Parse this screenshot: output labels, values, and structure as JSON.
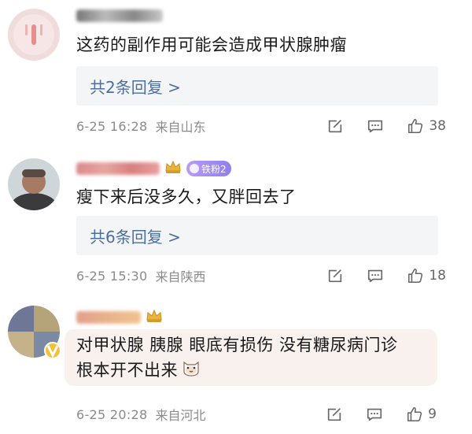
{
  "comments": [
    {
      "username": "",
      "body_lines": [
        "这药的副作用可能会造成甲状腺肿瘤"
      ],
      "replies_label": "共2条回复 >",
      "time": "6-25 16:28",
      "location": "来自山东",
      "like_count": "38"
    },
    {
      "username": "",
      "fan_badge": "铁粉2",
      "body_lines": [
        "瘦下来后没多久，又胖回去了"
      ],
      "replies_label": "共6条回复 >",
      "time": "6-25 15:30",
      "location": "来自陕西",
      "like_count": "18"
    },
    {
      "username": "",
      "body_lines": [
        "对甲状腺 胰腺 眼底有损伤 没有糖尿病门诊",
        "根本开不出来"
      ],
      "time": "6-25 20:28",
      "location": "来自河北",
      "like_count": "9"
    }
  ],
  "icons": {
    "repost": "repost-icon",
    "comment": "comment-icon",
    "like": "thumbs-up-icon",
    "emoji": "cat-face-emoji-icon",
    "verified": "verified-v-icon",
    "crown": "crown-icon"
  },
  "colors": {
    "link": "#4a6fa0",
    "meta": "#8a8a8a",
    "reply_bg": "#f4f5f7",
    "bubble_bg": "#f8f1ee",
    "fan_badge": "#9a86f2"
  }
}
